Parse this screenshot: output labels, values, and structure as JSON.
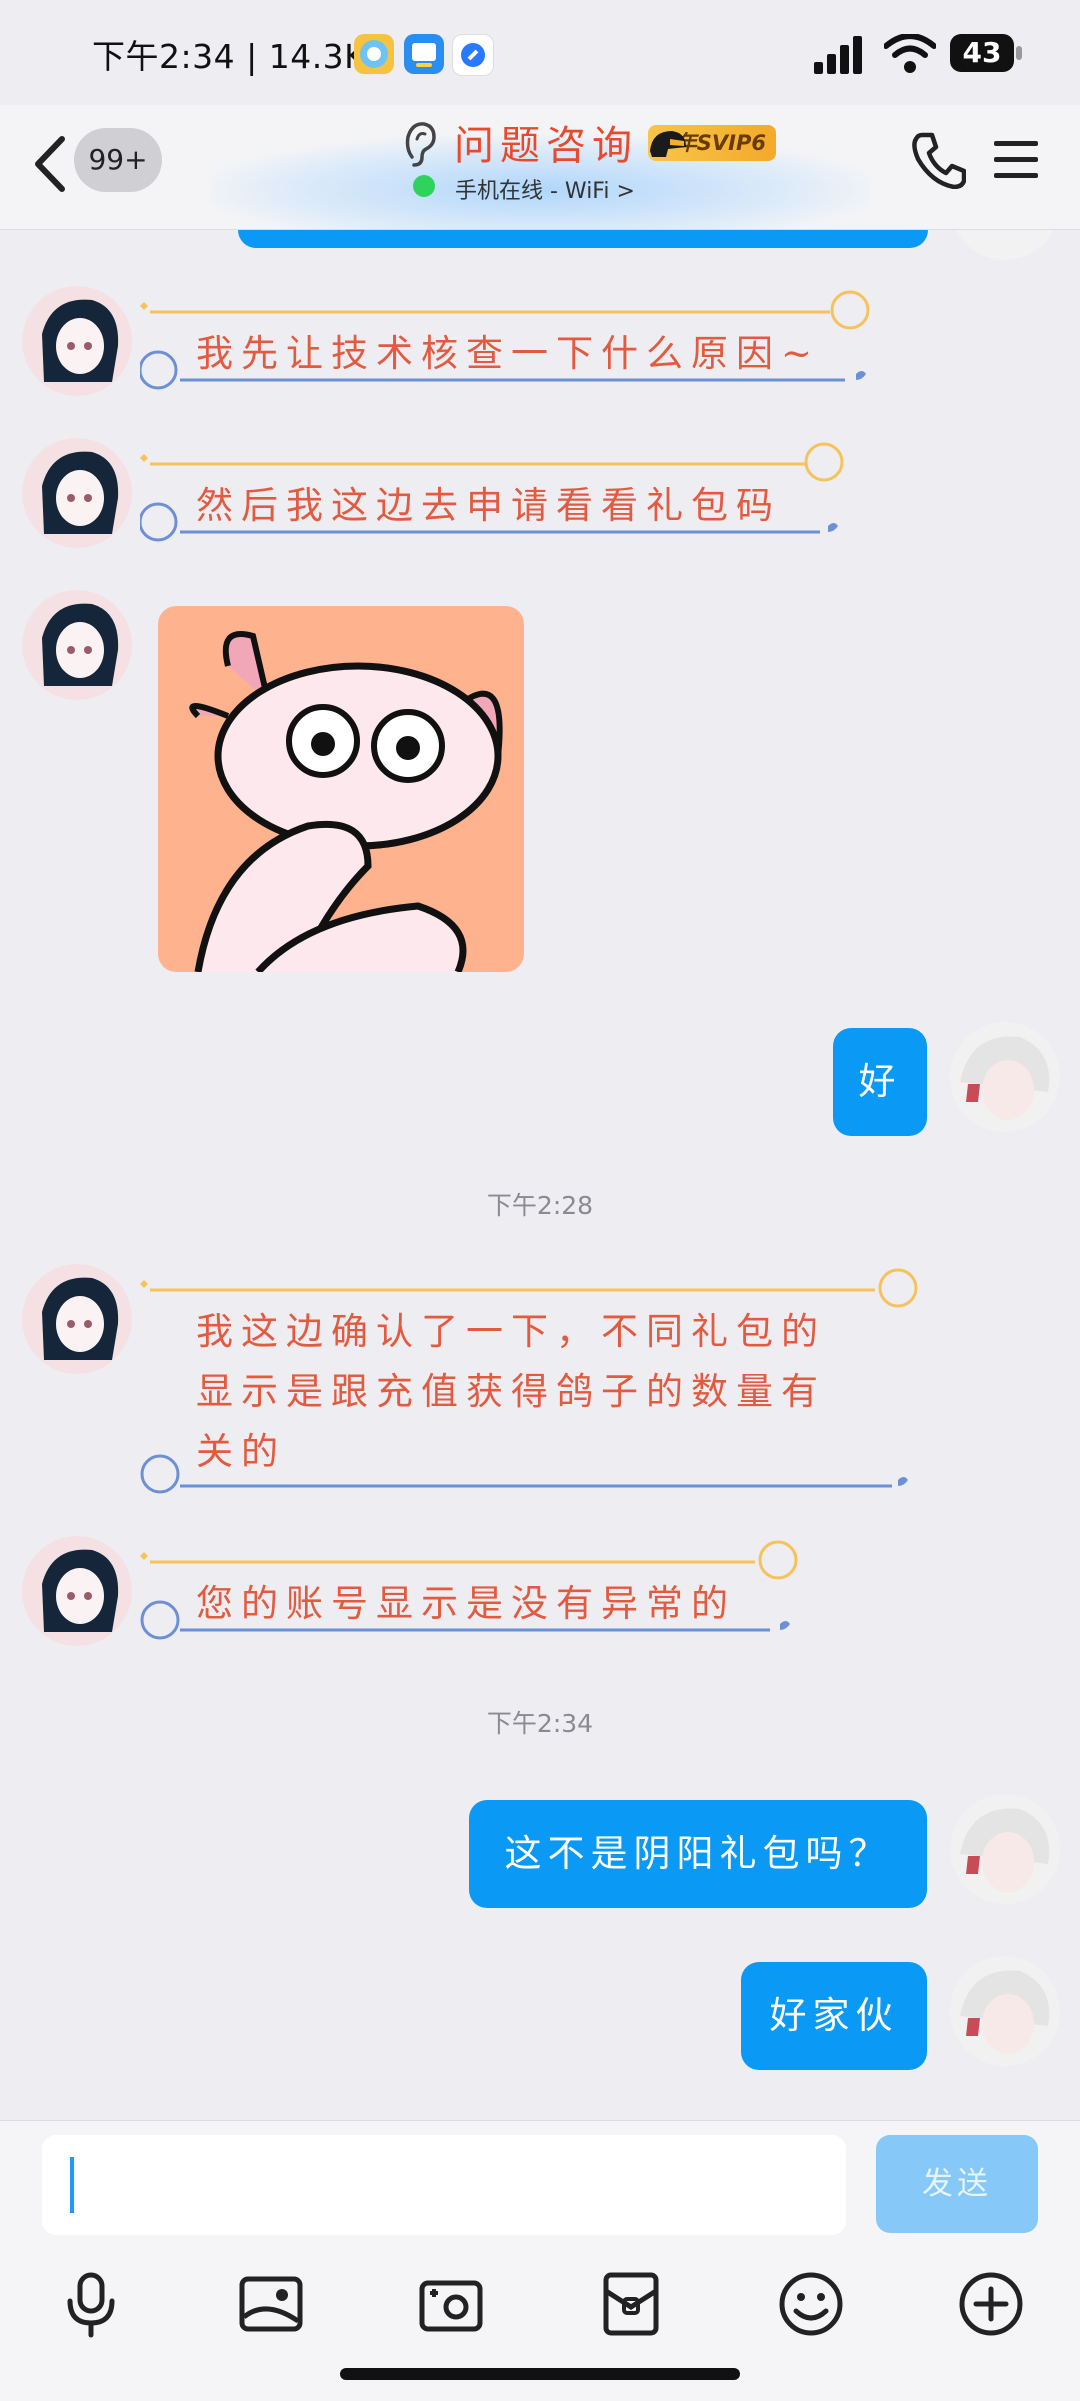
{
  "status_bar": {
    "time": "下午2:34 | 14.3K",
    "battery": "43"
  },
  "header": {
    "back_badge": "99+",
    "title": "问题咨询",
    "vip_badge": "年SVIP6",
    "online_status": "手机在线 - WiFi >"
  },
  "messages": {
    "m1": "我先让技术核查一下什么原因~",
    "m2": "然后我这边去申请看看礼包码",
    "m3_sticker": "axolotl-sticker",
    "m4": "好",
    "time_1": "下午2:28",
    "m5_line1": "我这边确认了一下，不同礼包的",
    "m5_line2": "显示是跟充值获得鸽子的数量有",
    "m5_line3": "关的",
    "m6": "您的账号显示是没有异常的",
    "time_2": "下午2:34",
    "m7": "这不是阴阳礼包吗？",
    "m8": "好家伙"
  },
  "input": {
    "value": "",
    "send_label": "发送"
  },
  "toolbar": {
    "icons": [
      "microphone-icon",
      "image-icon",
      "camera-icon",
      "red-packet-icon",
      "emoji-icon",
      "plus-icon"
    ]
  },
  "colors": {
    "accent_blue": "#0a99f5",
    "deco_text": "#e25b40",
    "deco_orange": "#f7c15c",
    "deco_blue": "#6d8fd6"
  }
}
